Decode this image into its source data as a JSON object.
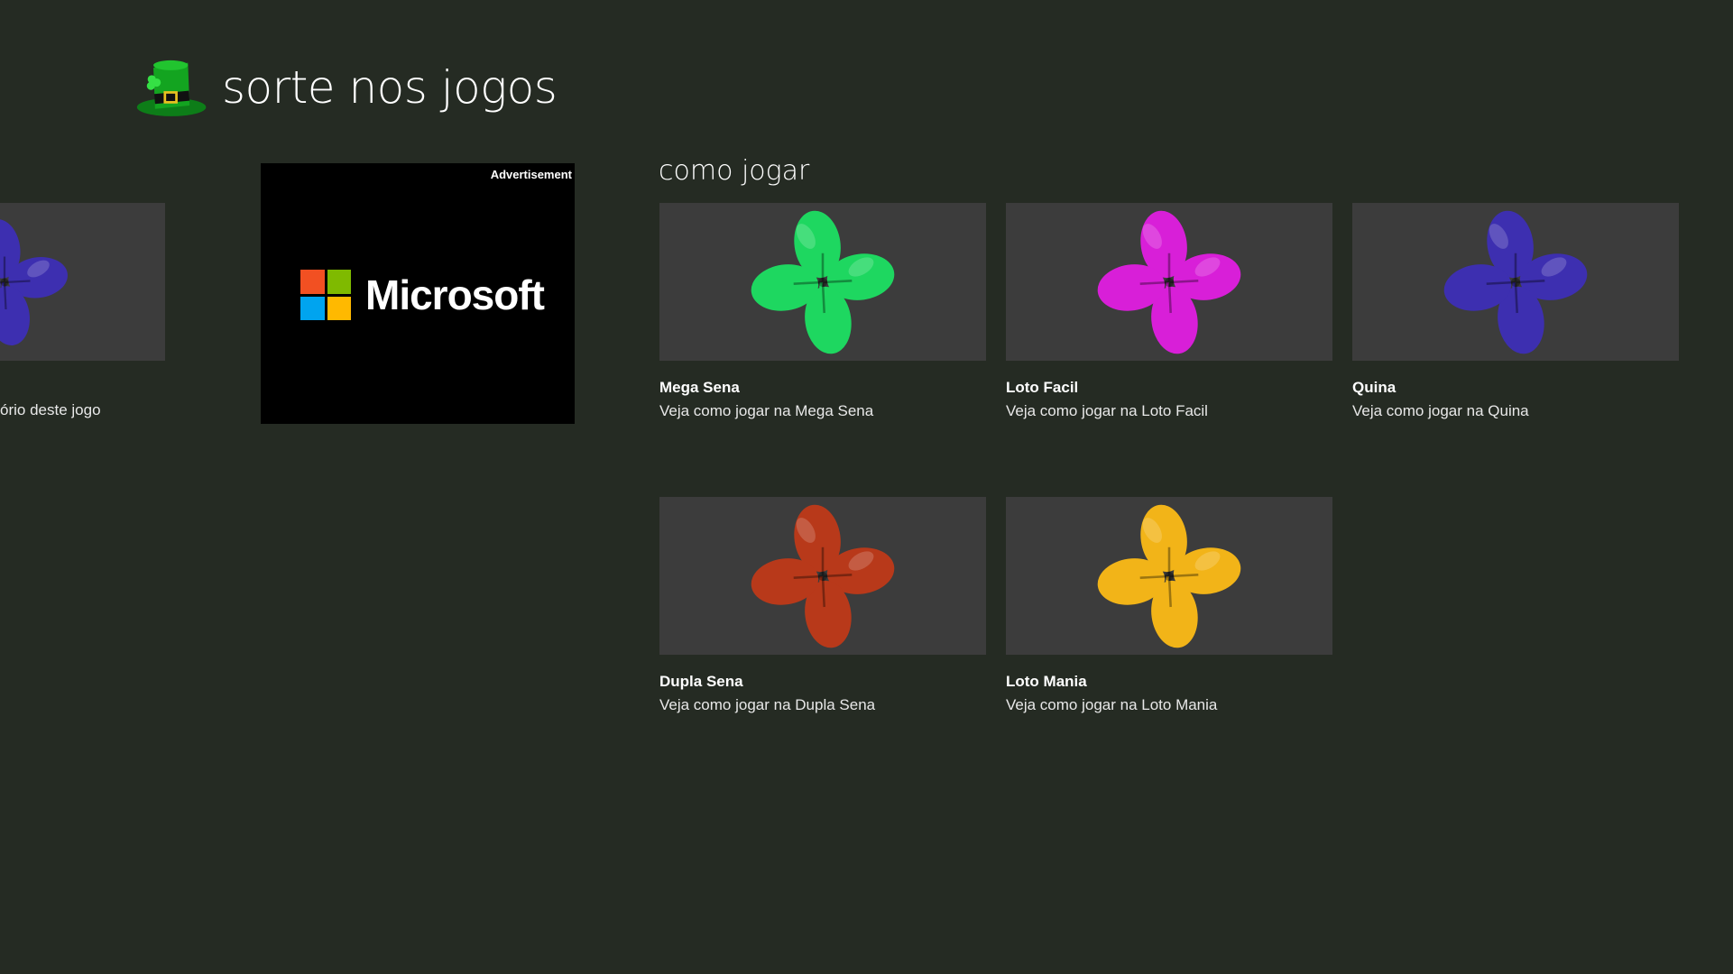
{
  "app": {
    "title": "sorte nos jogos",
    "logo_icon": "leprechaun-hat-icon"
  },
  "partial_tile": {
    "subtitle": "ório deste jogo",
    "clover_color": "#3d2fb0"
  },
  "ad": {
    "label": "Advertisement",
    "brand": "Microsoft",
    "logo_colors": [
      "#f25022",
      "#7fba00",
      "#00a4ef",
      "#ffb900"
    ]
  },
  "section": {
    "title": "como jogar"
  },
  "games": [
    {
      "title": "Mega Sena",
      "subtitle": "Veja como jogar na Mega Sena",
      "clover_color": "#1ed760"
    },
    {
      "title": "Loto Facil",
      "subtitle": "Veja como jogar na Loto Facil",
      "clover_color": "#d81fd8"
    },
    {
      "title": "Quina",
      "subtitle": "Veja como jogar na Quina",
      "clover_color": "#3d2fb0"
    },
    {
      "title": "Dupla Sena",
      "subtitle": "Veja como jogar na Dupla Sena",
      "clover_color": "#b8391a"
    },
    {
      "title": "Loto Mania",
      "subtitle": "Veja como jogar na Loto Mania",
      "clover_color": "#f2b418"
    }
  ]
}
